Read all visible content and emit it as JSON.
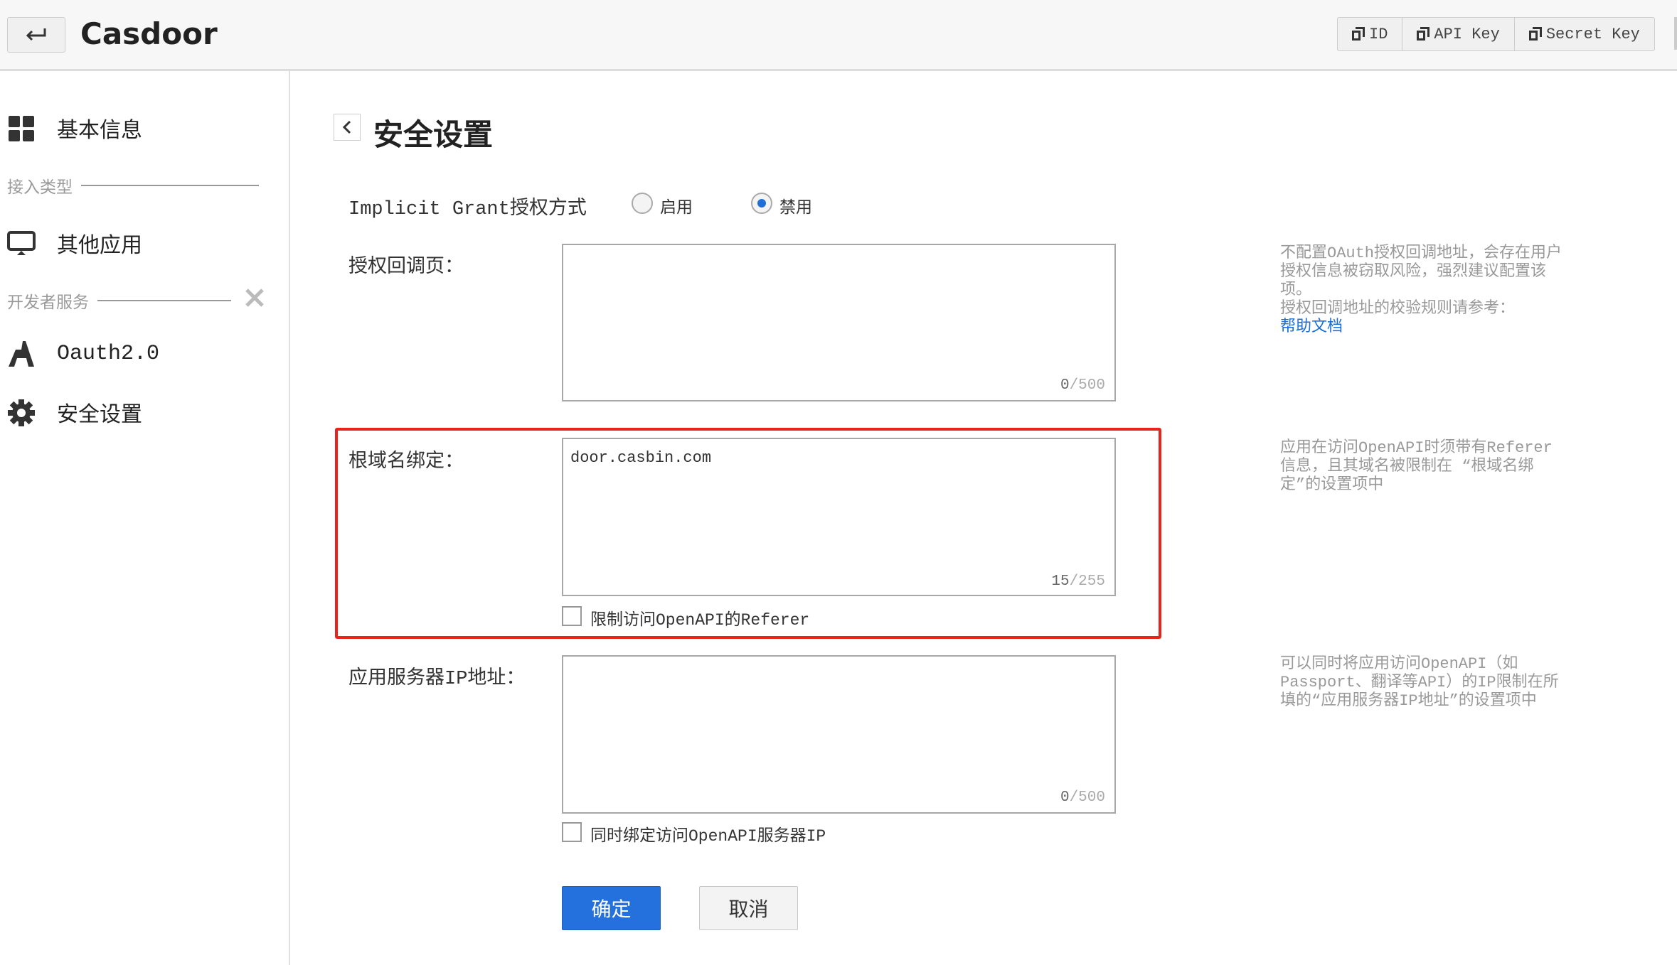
{
  "header": {
    "app_title": "Casdoor",
    "buttons": [
      {
        "label": "ID"
      },
      {
        "label": "API Key"
      },
      {
        "label": "Secret Key"
      }
    ]
  },
  "sidebar": {
    "basic_info": "基本信息",
    "section_access": "接入类型",
    "other_apps": "其他应用",
    "section_dev": "开发者服务",
    "oauth": "Oauth2.0",
    "security": "安全设置"
  },
  "page": {
    "title": "安全设置",
    "implicit": {
      "label": "Implicit Grant授权方式",
      "options": [
        "启用",
        "禁用"
      ],
      "selected": "禁用"
    },
    "callback": {
      "label": "授权回调页：",
      "value": "",
      "count": "0",
      "max": "/500",
      "help": [
        "不配置OAuth授权回调地址，会存在用户授权信息被窃取风险，强烈建议配置该项。",
        "授权回调地址的校验规则请参考："
      ],
      "help_link": "帮助文档"
    },
    "domain": {
      "label": "根域名绑定：",
      "value": "door.casbin.com",
      "count": "15",
      "max": "/255",
      "checkbox": "限制访问OpenAPI的Referer",
      "checked": false,
      "help": "应用在访问OpenAPI时须带有Referer信息，且其域名被限制在 “根域名绑定”的设置项中"
    },
    "server_ip": {
      "label": "应用服务器IP地址：",
      "value": "",
      "count": "0",
      "max": "/500",
      "checkbox": "同时绑定访问OpenAPI服务器IP",
      "checked": false,
      "help": "可以同时将应用访问OpenAPI（如Passport、翻译等API）的IP限制在所填的“应用服务器IP地址”的设置项中"
    },
    "confirm": "确定",
    "cancel": "取消"
  },
  "colors": {
    "primary": "#2470dc",
    "highlight_border": "#e8231b"
  }
}
